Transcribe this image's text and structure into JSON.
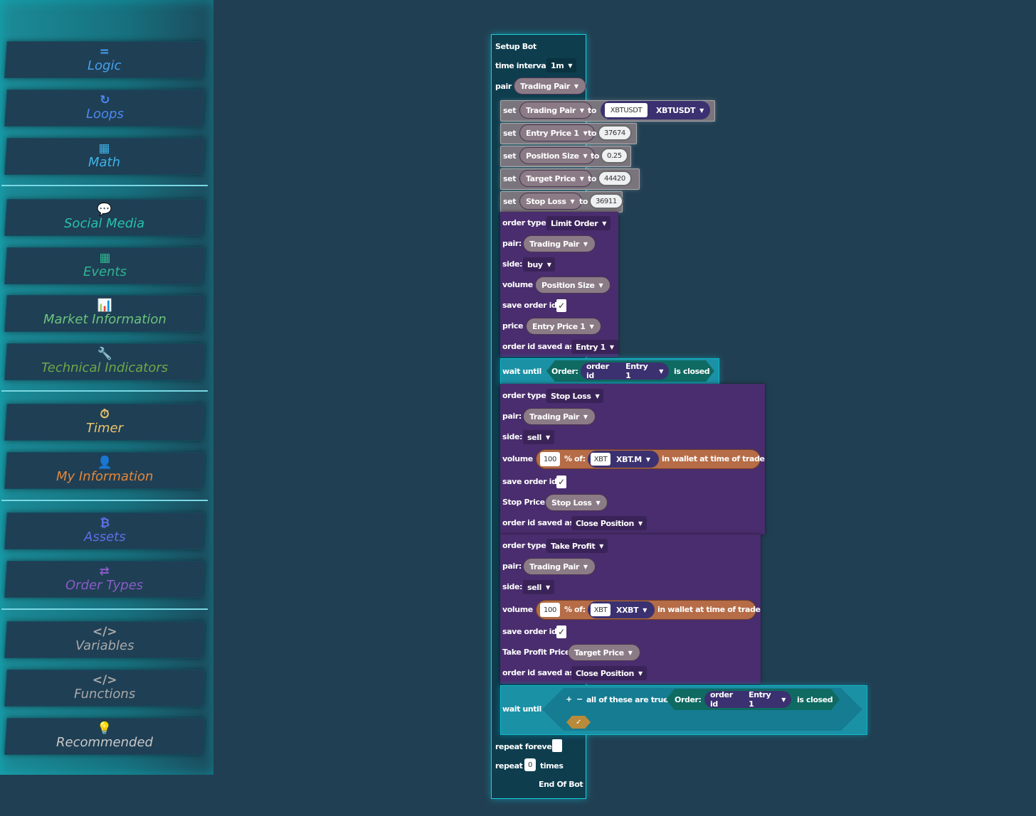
{
  "sidebar": {
    "categories": [
      {
        "label": "Logic",
        "icon": "equals-icon",
        "glyph": "=",
        "color": "#45a2ee"
      },
      {
        "label": "Loops",
        "icon": "refresh-icon",
        "glyph": "↻",
        "color": "#4d88f0"
      },
      {
        "label": "Math",
        "icon": "calculator-icon",
        "glyph": "▦",
        "color": "#3fb2e8"
      },
      {
        "label": "Social Media",
        "icon": "comments-icon",
        "glyph": "💬",
        "color": "#27c2a8"
      },
      {
        "label": "Events",
        "icon": "calendar-icon",
        "glyph": "▦",
        "color": "#2fb58f"
      },
      {
        "label": "Market Information",
        "icon": "bar-chart-icon",
        "glyph": "📊",
        "color": "#6cc47c"
      },
      {
        "label": "Technical Indicators",
        "icon": "wrench-icon",
        "glyph": "🔧",
        "color": "#6fa846"
      },
      {
        "label": "Timer",
        "icon": "stopwatch-icon",
        "glyph": "⏱",
        "color": "#e8c36b"
      },
      {
        "label": "My Information",
        "icon": "user-icon",
        "glyph": "👤",
        "color": "#e3873b"
      },
      {
        "label": "Assets",
        "icon": "bitcoin-icon",
        "glyph": "₿",
        "color": "#5f6fe6"
      },
      {
        "label": "Order Types",
        "icon": "swap-icon",
        "glyph": "⇄",
        "color": "#8a5cc6"
      },
      {
        "label": "Variables",
        "icon": "code-icon",
        "glyph": "</>",
        "color": "#a9a9a9"
      },
      {
        "label": "Functions",
        "icon": "code-icon",
        "glyph": "</>",
        "color": "#a9a9a9"
      },
      {
        "label": "Recommended",
        "icon": "lightbulb-icon",
        "glyph": "💡",
        "color": "#c8c8c8"
      }
    ]
  },
  "bot": {
    "title": "Setup Bot",
    "time_interval_label": "time interval",
    "time_interval_value": "1m",
    "pair_label": "pair",
    "pair_value": "Trading Pair",
    "set_label": "set",
    "to_label": "to",
    "sets": [
      {
        "var": "Trading Pair",
        "value": "XBTUSDT",
        "value2": "XBTUSDT"
      },
      {
        "var": "Entry Price 1",
        "value": "37674"
      },
      {
        "var": "Position Size",
        "value": "0.25"
      },
      {
        "var": "Target Price",
        "value": "44420"
      },
      {
        "var": "Stop Loss",
        "value": "36911"
      }
    ],
    "order1": {
      "order_type_label": "order type:",
      "order_type": "Limit Order",
      "pair_label": "pair:",
      "pair": "Trading Pair",
      "side_label": "side:",
      "side": "buy",
      "volume_label": "volume",
      "volume": "Position Size",
      "save_label": "save order id:",
      "save_check": "✓",
      "price_label": "price",
      "price": "Entry Price 1",
      "saved_as_label": "order id saved as:",
      "saved_as": "Entry 1"
    },
    "wait1": {
      "label": "wait until",
      "order_label": "Order:",
      "order_id_label": "order id",
      "order_id": "Entry 1",
      "status": "is closed"
    },
    "order2": {
      "order_type_label": "order type:",
      "order_type": "Stop Loss",
      "pair_label": "pair:",
      "pair": "Trading Pair",
      "side_label": "side:",
      "side": "sell",
      "volume_label": "volume",
      "pct": "100",
      "pct_of": "% of:",
      "asset": "XBT",
      "asset_dd": "XBT.M",
      "wallet": "in wallet at time of trade",
      "save_label": "save order id:",
      "save_check": "✓",
      "price_label": "Stop Price",
      "price": "Stop Loss",
      "saved_as_label": "order id saved as:",
      "saved_as": "Close Position"
    },
    "order3": {
      "order_type_label": "order type:",
      "order_type": "Take Profit",
      "pair_label": "pair:",
      "pair": "Trading Pair",
      "side_label": "side:",
      "side": "sell",
      "volume_label": "volume",
      "pct": "100",
      "pct_of": "% of:",
      "asset": "XBT",
      "asset_dd": "XXBT",
      "wallet": "in wallet at time of trade",
      "save_label": "save order id:",
      "save_check": "✓",
      "price_label": "Take Profit Price",
      "price": "Target Price",
      "saved_as_label": "order id saved as:",
      "saved_as": "Close Position"
    },
    "wait2": {
      "label": "wait until",
      "plus": "+",
      "minus": "−",
      "all_true": "all of these are true",
      "order_label": "Order:",
      "order_id_label": "order id",
      "order_id": "Entry 1",
      "status": "is closed",
      "check": "✓"
    },
    "repeat_forever_label": "repeat forever",
    "repeat_label": "repeat",
    "repeat_count": "0",
    "times_label": "times",
    "end_label": "End Of Bot"
  },
  "caret": "▼"
}
